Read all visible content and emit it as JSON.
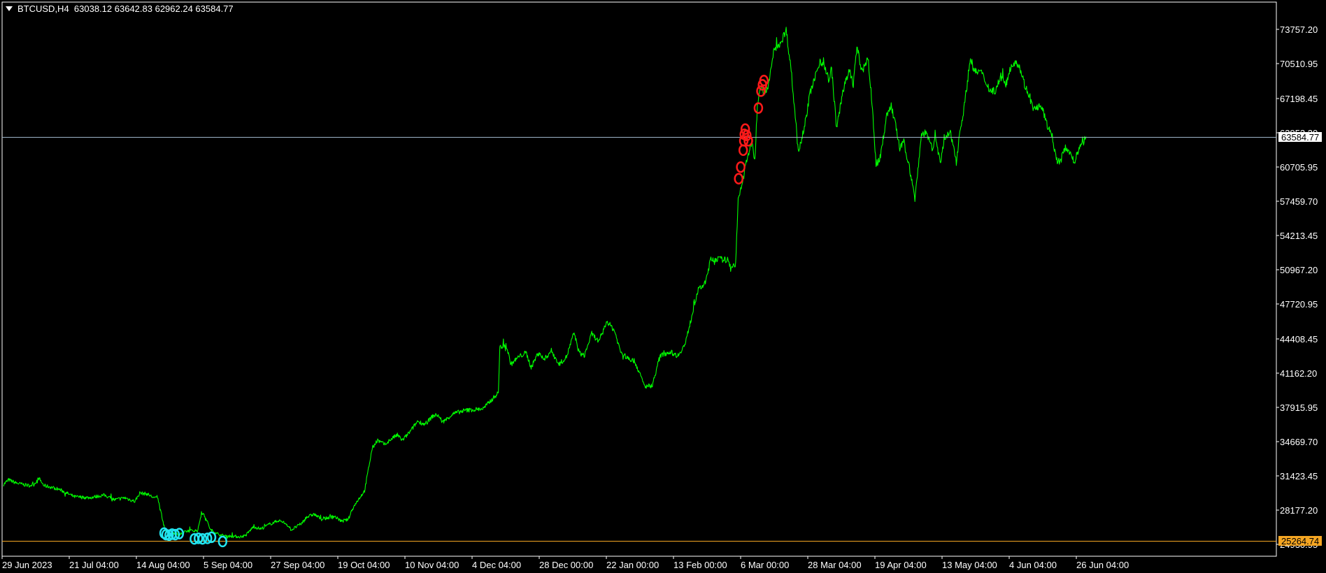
{
  "header": {
    "symbol": "BTCUSD,H4",
    "ohlc": "63038.12 63642.83 62962.24 63584.77"
  },
  "colors": {
    "background": "#000000",
    "price_line": "#00ff00",
    "frame": "#ffffff",
    "bid_line": "#9fb4c8",
    "level_line": "#f5a623",
    "sell_signal": "#ff1a1a",
    "buy_signal": "#22e5f0"
  },
  "icons": {
    "collapse": "triangle-down-icon"
  },
  "chart_data": {
    "type": "line",
    "title": "",
    "xlabel": "",
    "ylabel": "",
    "ylim": [
      23750,
      75300
    ],
    "y_ticks": [
      73757.2,
      70510.95,
      67198.45,
      63952.2,
      60705.95,
      57459.7,
      54213.45,
      50967.2,
      47720.95,
      44408.45,
      41162.2,
      37915.95,
      34669.7,
      31423.45,
      28177.2,
      24930.95
    ],
    "y_tick_labels": [
      "73757.20",
      "70510.95",
      "67198.45",
      "63952.20",
      "60705.95",
      "57459.70",
      "54213.45",
      "50967.20",
      "47720.95",
      "44408.45",
      "41162.20",
      "37915.95",
      "34669.70",
      "31423.45",
      "28177.20",
      "24930.95"
    ],
    "x_tick_labels": [
      "29 Jun 2023",
      "21 Jul 04:00",
      "14 Aug 04:00",
      "5 Sep 04:00",
      "27 Sep 04:00",
      "19 Oct 04:00",
      "10 Nov 04:00",
      "4 Dec 04:00",
      "28 Dec 00:00",
      "22 Jan 00:00",
      "13 Feb 00:00",
      "6 Mar 00:00",
      "28 Mar 04:00",
      "19 Apr 04:00",
      "13 May 04:00",
      "4 Jun 04:00",
      "26 Jun 04:00"
    ],
    "bars_total": 1544,
    "bar_step": 100,
    "price_labels": [
      {
        "name": "current-price",
        "value": 63584.77,
        "label": "63584.77"
      },
      {
        "name": "level",
        "value": 25264.74,
        "label": "25264.74"
      }
    ],
    "series": [
      {
        "values": [
          [
            0,
            30600
          ],
          [
            10,
            31050
          ],
          [
            25,
            30750
          ],
          [
            50,
            30500
          ],
          [
            60,
            30600
          ],
          [
            70,
            31200
          ],
          [
            80,
            30500
          ],
          [
            90,
            30400
          ],
          [
            110,
            30150
          ],
          [
            140,
            29450
          ],
          [
            170,
            29350
          ],
          [
            200,
            29600
          ],
          [
            220,
            29150
          ],
          [
            240,
            29350
          ],
          [
            260,
            29000
          ],
          [
            270,
            29800
          ],
          [
            285,
            29700
          ],
          [
            300,
            29300
          ],
          [
            305,
            29450
          ],
          [
            315,
            27200
          ],
          [
            322,
            26100
          ],
          [
            335,
            26000
          ],
          [
            350,
            25900
          ],
          [
            365,
            26200
          ],
          [
            385,
            26250
          ],
          [
            392,
            28000
          ],
          [
            400,
            27500
          ],
          [
            410,
            26300
          ],
          [
            430,
            25800
          ],
          [
            450,
            25700
          ],
          [
            470,
            25650
          ],
          [
            480,
            25800
          ],
          [
            495,
            26600
          ],
          [
            510,
            26400
          ],
          [
            525,
            26800
          ],
          [
            545,
            27200
          ],
          [
            560,
            26900
          ],
          [
            570,
            26300
          ],
          [
            590,
            26900
          ],
          [
            600,
            27500
          ],
          [
            615,
            27800
          ],
          [
            630,
            27300
          ],
          [
            655,
            27600
          ],
          [
            670,
            27100
          ],
          [
            683,
            27300
          ],
          [
            690,
            28200
          ],
          [
            700,
            29000
          ],
          [
            715,
            30000
          ],
          [
            730,
            34000
          ],
          [
            740,
            34800
          ],
          [
            755,
            34400
          ],
          [
            770,
            35000
          ],
          [
            780,
            35300
          ],
          [
            790,
            34800
          ],
          [
            805,
            35600
          ],
          [
            820,
            36600
          ],
          [
            835,
            36300
          ],
          [
            850,
            37100
          ],
          [
            860,
            37200
          ],
          [
            870,
            36500
          ],
          [
            890,
            37300
          ],
          [
            910,
            37600
          ],
          [
            930,
            37700
          ],
          [
            950,
            37800
          ],
          [
            980,
            39300
          ],
          [
            983,
            43600
          ],
          [
            995,
            43900
          ],
          [
            1005,
            42000
          ],
          [
            1020,
            42700
          ],
          [
            1035,
            43100
          ],
          [
            1045,
            41700
          ],
          [
            1060,
            43200
          ],
          [
            1070,
            42400
          ],
          [
            1085,
            43300
          ],
          [
            1100,
            42000
          ],
          [
            1115,
            42700
          ],
          [
            1130,
            45000
          ],
          [
            1140,
            43100
          ],
          [
            1150,
            42800
          ],
          [
            1165,
            44900
          ],
          [
            1180,
            44100
          ],
          [
            1195,
            46100
          ],
          [
            1210,
            45200
          ],
          [
            1222,
            43200
          ],
          [
            1235,
            42600
          ],
          [
            1250,
            42300
          ],
          [
            1270,
            39900
          ],
          [
            1285,
            40000
          ],
          [
            1300,
            42800
          ],
          [
            1320,
            43200
          ],
          [
            1335,
            42800
          ],
          [
            1350,
            43900
          ],
          [
            1375,
            49000
          ],
          [
            1390,
            49700
          ],
          [
            1400,
            51900
          ],
          [
            1415,
            52000
          ],
          [
            1430,
            51900
          ],
          [
            1442,
            51300
          ],
          [
            1450,
            51500
          ],
          [
            1455,
            57500
          ],
          [
            1465,
            59600
          ],
          [
            1470,
            61000
          ],
          [
            1478,
            62500
          ],
          [
            1483,
            62800
          ],
          [
            1488,
            61300
          ],
          [
            1493,
            66600
          ],
          [
            1498,
            68500
          ],
          [
            1505,
            67800
          ],
          [
            1515,
            68300
          ],
          [
            1525,
            71700
          ],
          [
            1540,
            72600
          ],
          [
            1550,
            73700
          ],
          [
            1560,
            69900
          ],
          [
            1565,
            67000
          ],
          [
            1575,
            62200
          ],
          [
            1590,
            65500
          ],
          [
            1598,
            67900
          ],
          [
            1607,
            69100
          ],
          [
            1617,
            70800
          ],
          [
            1625,
            70400
          ],
          [
            1635,
            68900
          ],
          [
            1640,
            70100
          ],
          [
            1650,
            64300
          ],
          [
            1662,
            67900
          ],
          [
            1675,
            69800
          ],
          [
            1683,
            68600
          ],
          [
            1690,
            72100
          ],
          [
            1700,
            69700
          ],
          [
            1712,
            71100
          ],
          [
            1720,
            66800
          ],
          [
            1728,
            61000
          ],
          [
            1735,
            61300
          ],
          [
            1742,
            63400
          ],
          [
            1750,
            65800
          ],
          [
            1758,
            66500
          ],
          [
            1768,
            64400
          ],
          [
            1775,
            62400
          ],
          [
            1783,
            63100
          ],
          [
            1795,
            60400
          ],
          [
            1805,
            57700
          ],
          [
            1818,
            63800
          ],
          [
            1828,
            64000
          ],
          [
            1840,
            62200
          ],
          [
            1845,
            63900
          ],
          [
            1855,
            61100
          ],
          [
            1865,
            63500
          ],
          [
            1875,
            63900
          ],
          [
            1888,
            61400
          ],
          [
            1893,
            63800
          ],
          [
            1903,
            66500
          ],
          [
            1915,
            71100
          ],
          [
            1923,
            69700
          ],
          [
            1935,
            69800
          ],
          [
            1945,
            68800
          ],
          [
            1955,
            67900
          ],
          [
            1965,
            68000
          ],
          [
            1975,
            69300
          ],
          [
            1985,
            68400
          ],
          [
            1995,
            70300
          ],
          [
            2005,
            70800
          ],
          [
            2013,
            70100
          ],
          [
            2023,
            68400
          ],
          [
            2031,
            67500
          ],
          [
            2040,
            66100
          ],
          [
            2050,
            66500
          ],
          [
            2060,
            65900
          ],
          [
            2068,
            64400
          ],
          [
            2075,
            64100
          ],
          [
            2085,
            61400
          ],
          [
            2093,
            61200
          ],
          [
            2103,
            62600
          ],
          [
            2113,
            62100
          ],
          [
            2120,
            61100
          ],
          [
            2130,
            62500
          ],
          [
            2138,
            63000
          ],
          [
            2144,
            63585
          ]
        ]
      }
    ],
    "sell_signals": [
      [
        1456,
        59600
      ],
      [
        1460,
        60700
      ],
      [
        1465,
        62300
      ],
      [
        1466,
        63200
      ],
      [
        1467,
        63800
      ],
      [
        1469,
        64300
      ],
      [
        1472,
        63700
      ],
      [
        1475,
        63200
      ],
      [
        1495,
        66300
      ],
      [
        1500,
        67900
      ],
      [
        1503,
        68500
      ],
      [
        1506,
        68900
      ]
    ],
    "buy_signals": [
      [
        318,
        26000
      ],
      [
        322,
        25850
      ],
      [
        328,
        25800
      ],
      [
        334,
        25900
      ],
      [
        340,
        25850
      ],
      [
        348,
        25950
      ],
      [
        378,
        25450
      ],
      [
        386,
        25500
      ],
      [
        394,
        25450
      ],
      [
        404,
        25500
      ],
      [
        412,
        25600
      ],
      [
        434,
        25200
      ]
    ]
  }
}
